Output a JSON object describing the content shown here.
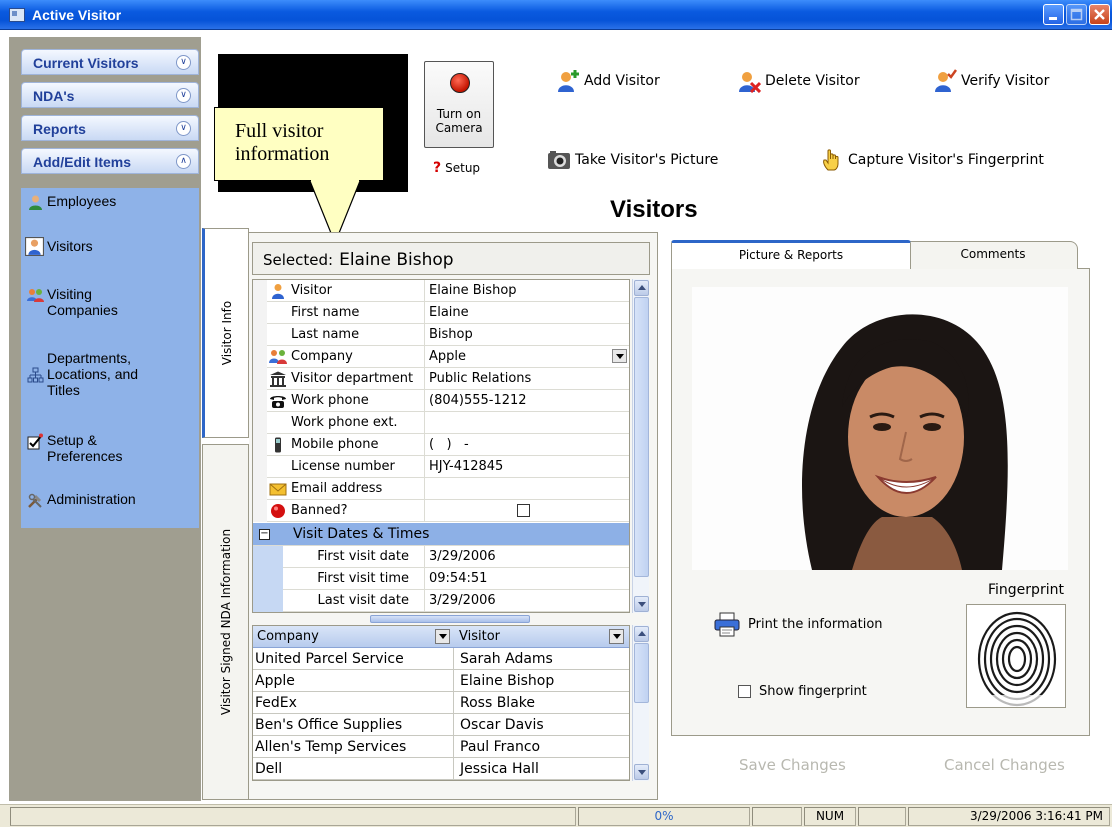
{
  "window": {
    "title": "Active Visitor"
  },
  "sidebar": {
    "headers": [
      {
        "label": "Current Visitors",
        "state": "collapsed"
      },
      {
        "label": "NDA's",
        "state": "collapsed"
      },
      {
        "label": "Reports",
        "state": "collapsed"
      },
      {
        "label": "Add/Edit Items",
        "state": "expanded"
      }
    ],
    "items": [
      {
        "label": "Employees",
        "icon": "employee-icon"
      },
      {
        "label": "Visitors",
        "icon": "visitor-icon",
        "selected": true
      },
      {
        "label": "Visiting\nCompanies",
        "icon": "companies-icon"
      },
      {
        "label": "Departments,\nLocations, and\nTitles",
        "icon": "org-chart-icon"
      },
      {
        "label": "Setup &\nPreferences",
        "icon": "setup-icon"
      },
      {
        "label": "Administration",
        "icon": "tools-icon"
      }
    ]
  },
  "toolbar": {
    "turn_on_camera": "Turn on\nCamera",
    "setup": "Setup",
    "add_visitor": "Add Visitor",
    "delete_visitor": "Delete Visitor",
    "verify_visitor": "Verify Visitor",
    "take_picture": "Take Visitor's Picture",
    "capture_fingerprint": "Capture Visitor's Fingerprint"
  },
  "callout": {
    "text": "Full visitor\ninformation"
  },
  "page_title": "Visitors",
  "vertical_tabs": {
    "visitor_info": "Visitor Info",
    "nda_info": "Visitor Signed NDA Information"
  },
  "selected": {
    "prefix": "Selected:",
    "name": "Elaine Bishop"
  },
  "properties": [
    {
      "label": "Visitor",
      "value": "Elaine Bishop",
      "icon": "visitor-icon"
    },
    {
      "label": "First name",
      "value": "Elaine"
    },
    {
      "label": "Last name",
      "value": "Bishop"
    },
    {
      "label": "Company",
      "value": "Apple",
      "icon": "companies-icon",
      "dropdown": true
    },
    {
      "label": "Visitor department",
      "value": "Public Relations",
      "icon": "building-icon"
    },
    {
      "label": "Work phone",
      "value": "(804)555-1212",
      "icon": "telephone-icon"
    },
    {
      "label": "Work phone ext.",
      "value": ""
    },
    {
      "label": "Mobile phone",
      "value": "(   )   -",
      "icon": "mobile-phone-icon"
    },
    {
      "label": "License number",
      "value": "HJY-412845"
    },
    {
      "label": "Email address",
      "value": "",
      "icon": "envelope-icon"
    },
    {
      "label": "Banned?",
      "value": "",
      "icon": "banned-icon",
      "checkbox": true,
      "checked": false
    }
  ],
  "visit_group": {
    "title": "Visit Dates & Times",
    "rows": [
      {
        "label": "First visit date",
        "value": "3/29/2006"
      },
      {
        "label": "First visit time",
        "value": "09:54:51"
      },
      {
        "label": "Last visit date",
        "value": "3/29/2006"
      }
    ]
  },
  "visitor_table": {
    "columns": [
      "Company",
      "Visitor"
    ],
    "rows": [
      [
        "United Parcel Service",
        "Sarah Adams"
      ],
      [
        "Apple",
        "Elaine Bishop"
      ],
      [
        "FedEx",
        "Ross Blake"
      ],
      [
        "Ben's Office Supplies",
        "Oscar Davis"
      ],
      [
        "Allen's Temp Services",
        "Paul Franco"
      ],
      [
        "Dell",
        "Jessica Hall"
      ]
    ]
  },
  "right_tabs": {
    "picture": "Picture & Reports",
    "comments": "Comments"
  },
  "fingerprint": {
    "label": "Fingerprint"
  },
  "print_info": "Print the information",
  "show_fingerprint": {
    "label": "Show fingerprint",
    "checked": false
  },
  "actions": {
    "save": "Save Changes",
    "cancel": "Cancel Changes"
  },
  "statusbar": {
    "progress": "0%",
    "num": "NUM",
    "datetime": "3/29/2006 3:16:41 PM"
  },
  "colors": {
    "accent": "#2d66c8",
    "nav_panel": "#8eb2e8",
    "group_row": "#8db0e6",
    "callout": "#ffffc2"
  }
}
